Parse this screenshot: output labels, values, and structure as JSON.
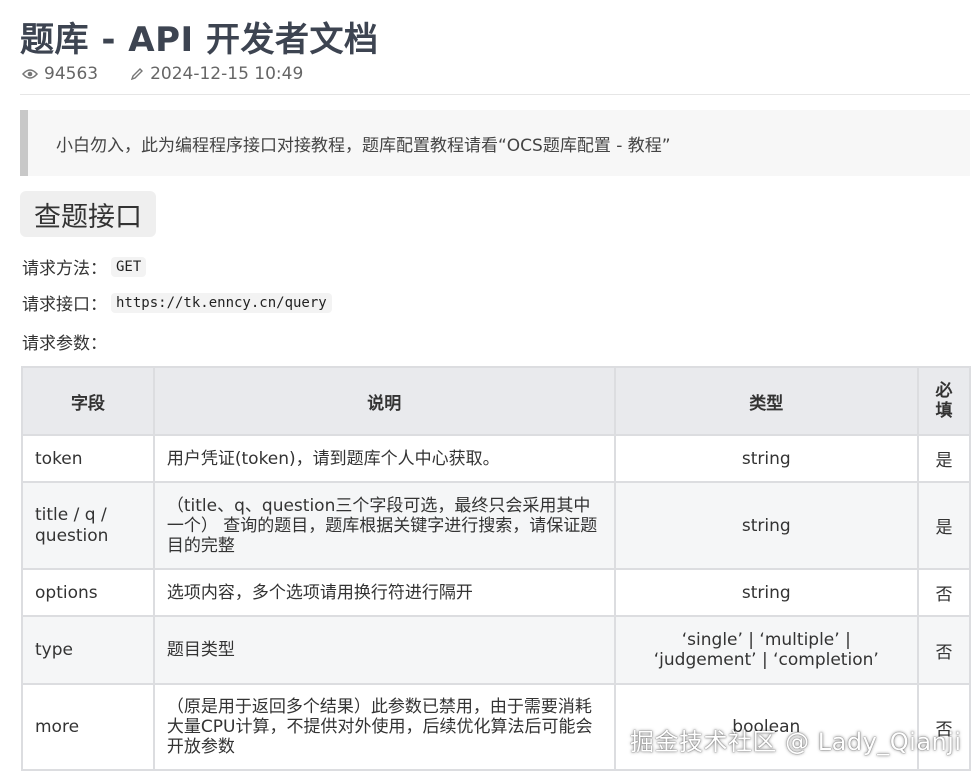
{
  "page": {
    "title": "题库 - API 开发者文档",
    "views": "94563",
    "updated": "2024-12-15 10:49",
    "icons": {
      "views": "eye-icon",
      "updated": "pencil-icon"
    }
  },
  "notice": "小白勿入，此为编程程序接口对接教程，题库配置教程请看“OCS题库配置 - 教程”",
  "section": {
    "title": "查题接口",
    "method_label": "请求方法：",
    "method_value": "GET",
    "endpoint_label": "请求接口：",
    "endpoint_value": "https://tk.enncy.cn/query",
    "params_label": "请求参数："
  },
  "table": {
    "headers": [
      "字段",
      "说明",
      "类型",
      "必填"
    ],
    "rows": [
      {
        "field": "token",
        "desc": "用户凭证(token)，请到题库个人中心获取。",
        "type": "string",
        "required": "是"
      },
      {
        "field": "title / q / question",
        "desc": "（title、q、question三个字段可选，最终只会采用其中一个） 查询的题目，题库根据关键字进行搜索，请保证题目的完整",
        "type": "string",
        "required": "是"
      },
      {
        "field": "options",
        "desc": "选项内容，多个选项请用换行符进行隔开",
        "type": "string",
        "required": "否"
      },
      {
        "field": "type",
        "desc": "题目类型",
        "type": "‘single’ | ‘multiple’ | ‘judgement’ | ‘completion’",
        "required": "否"
      },
      {
        "field": "more",
        "desc": "（原是用于返回多个结果）此参数已禁用，由于需要消耗大量CPU计算，不提供对外使用，后续优化算法后可能会开放参数",
        "type": "boolean",
        "required": "否"
      }
    ]
  },
  "watermark": "掘金技术社区 @ Lady_Qianji"
}
